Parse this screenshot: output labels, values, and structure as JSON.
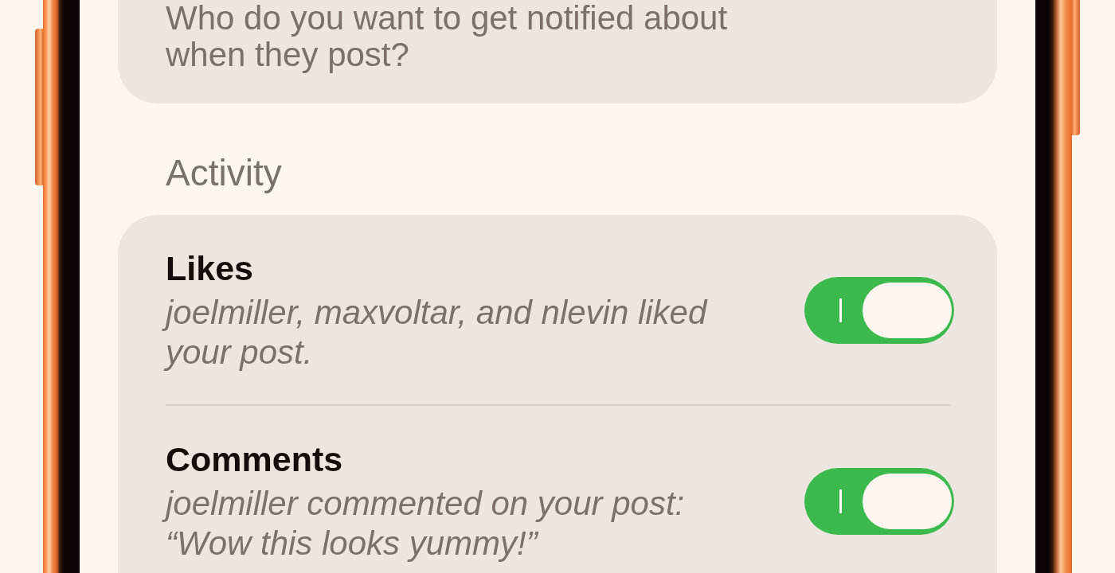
{
  "intro_card": {
    "text": "Who do you want to get notified about when they post?"
  },
  "sections": [
    {
      "title": "Activity",
      "items": [
        {
          "title": "Likes",
          "description": "joelmiller, maxvoltar, and nlevin liked your post.",
          "on": true
        },
        {
          "title": "Comments",
          "description": "joelmiller commented on your post: “Wow this looks yummy!”",
          "on": true
        }
      ]
    }
  ]
}
